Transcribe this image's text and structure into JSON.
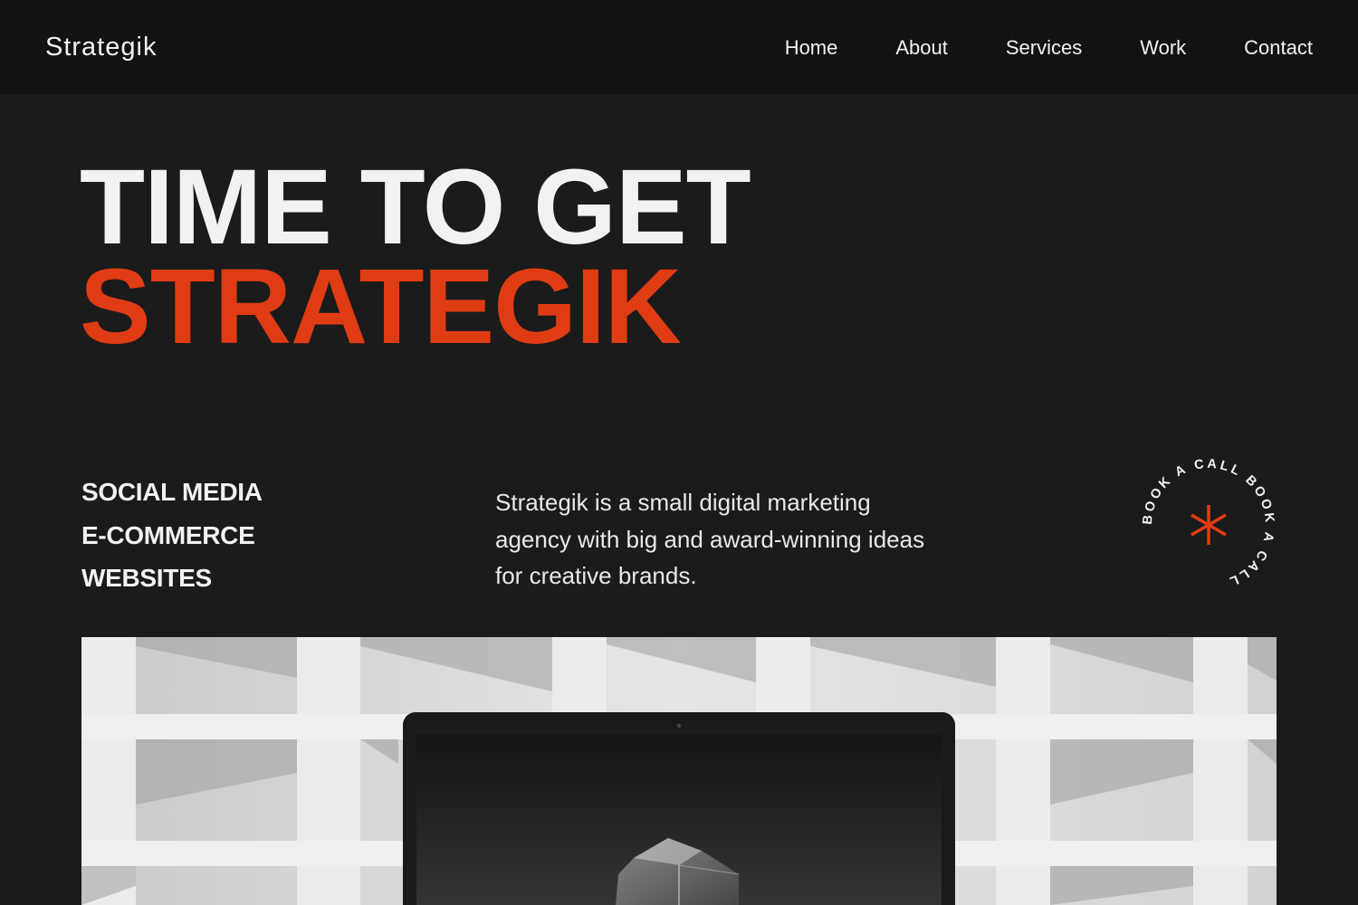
{
  "header": {
    "brand": "Strategik",
    "nav": [
      "Home",
      "About",
      "Services",
      "Work",
      "Contact"
    ]
  },
  "hero": {
    "line1": "TIME TO GET",
    "line2": "STRATEGIK"
  },
  "services": [
    "SOCIAL MEDIA",
    "E-COMMERCE",
    "WEBSITES"
  ],
  "description": "Strategik is a small digital marketing agency with big and award-winning ideas for creative brands.",
  "cta_badge": {
    "ring_text": "BOOK A CALL BOOK A CALL ",
    "icon": "asterisk-icon"
  },
  "hero_image": {
    "description": "laptop-on-architectural-background"
  },
  "colors": {
    "accent": "#e03c14",
    "background": "#1b1b1b",
    "header_bg": "#121212",
    "text": "#f2f2f2"
  }
}
